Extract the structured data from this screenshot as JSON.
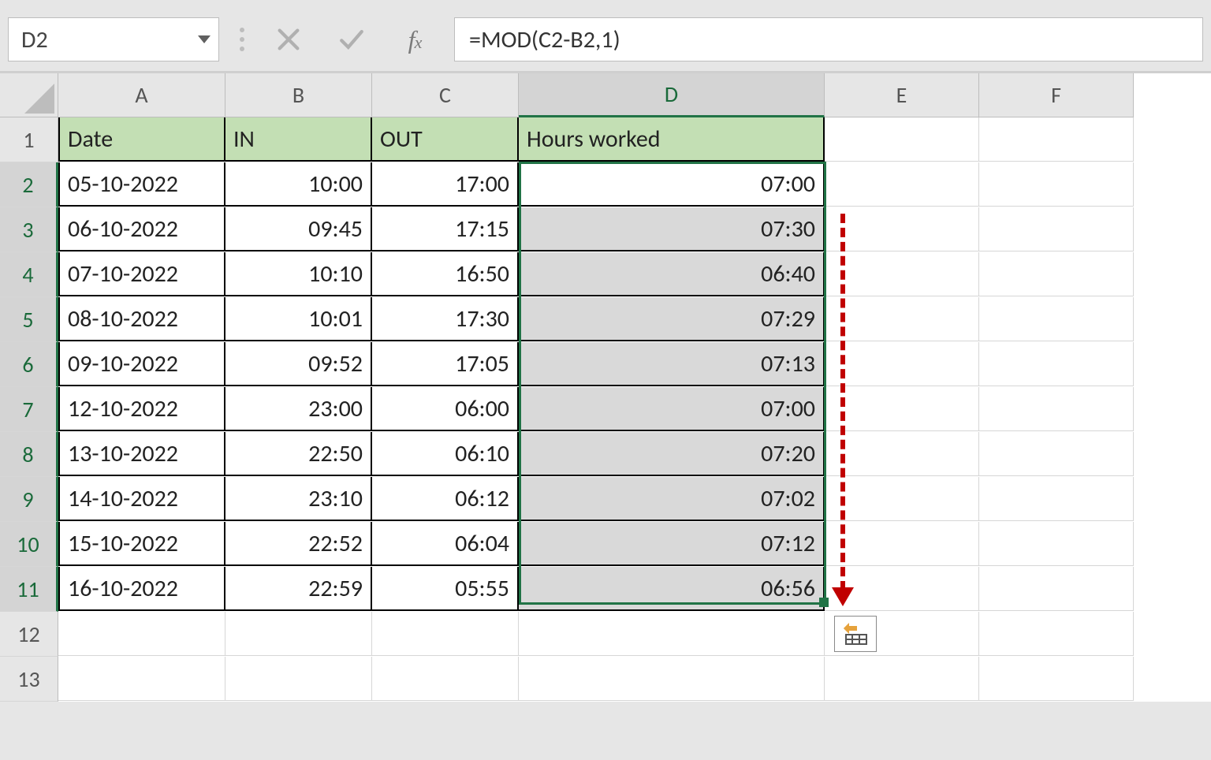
{
  "namebox": "D2",
  "formula": "=MOD(C2-B2,1)",
  "col_headers": [
    "A",
    "B",
    "C",
    "D",
    "E",
    "F"
  ],
  "active_col_index": 3,
  "row_headers": [
    "1",
    "2",
    "3",
    "4",
    "5",
    "6",
    "7",
    "8",
    "9",
    "10",
    "11",
    "12",
    "13"
  ],
  "active_row_from": 1,
  "active_row_to": 10,
  "table": {
    "headers": [
      "Date",
      "IN",
      "OUT",
      "Hours worked"
    ],
    "rows": [
      {
        "date": "05-10-2022",
        "in": "10:00",
        "out": "17:00",
        "hours": "07:00"
      },
      {
        "date": "06-10-2022",
        "in": "09:45",
        "out": "17:15",
        "hours": "07:30"
      },
      {
        "date": "07-10-2022",
        "in": "10:10",
        "out": "16:50",
        "hours": "06:40"
      },
      {
        "date": "08-10-2022",
        "in": "10:01",
        "out": "17:30",
        "hours": "07:29"
      },
      {
        "date": "09-10-2022",
        "in": "09:52",
        "out": "17:05",
        "hours": "07:13"
      },
      {
        "date": "12-10-2022",
        "in": "23:00",
        "out": "06:00",
        "hours": "07:00"
      },
      {
        "date": "13-10-2022",
        "in": "22:50",
        "out": "06:10",
        "hours": "07:20"
      },
      {
        "date": "14-10-2022",
        "in": "23:10",
        "out": "06:12",
        "hours": "07:02"
      },
      {
        "date": "15-10-2022",
        "in": "22:52",
        "out": "06:04",
        "hours": "07:12"
      },
      {
        "date": "16-10-2022",
        "in": "22:59",
        "out": "05:55",
        "hours": "06:56"
      }
    ]
  },
  "chart_data": {
    "type": "table",
    "title": "Hours worked",
    "categories": [
      "05-10-2022",
      "06-10-2022",
      "07-10-2022",
      "08-10-2022",
      "09-10-2022",
      "12-10-2022",
      "13-10-2022",
      "14-10-2022",
      "15-10-2022",
      "16-10-2022"
    ],
    "series": [
      {
        "name": "IN",
        "values": [
          "10:00",
          "09:45",
          "10:10",
          "10:01",
          "09:52",
          "23:00",
          "22:50",
          "23:10",
          "22:52",
          "22:59"
        ]
      },
      {
        "name": "OUT",
        "values": [
          "17:00",
          "17:15",
          "16:50",
          "17:30",
          "17:05",
          "06:00",
          "06:10",
          "06:12",
          "06:04",
          "05:55"
        ]
      },
      {
        "name": "Hours worked",
        "values": [
          "07:00",
          "07:30",
          "06:40",
          "07:29",
          "07:13",
          "07:00",
          "07:20",
          "07:02",
          "07:12",
          "06:56"
        ]
      }
    ]
  }
}
